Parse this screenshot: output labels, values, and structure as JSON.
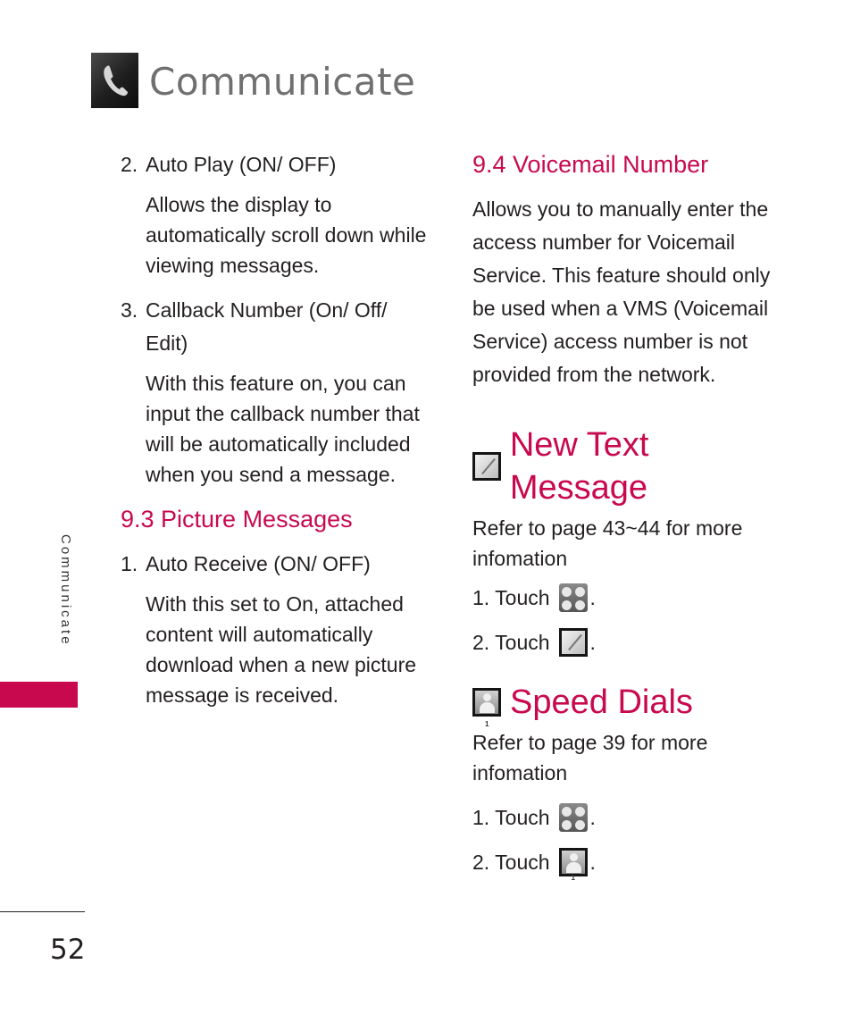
{
  "header": {
    "icon": "phone-icon",
    "title": "Communicate"
  },
  "side_tab": {
    "label": "Communicate",
    "accent_color": "#c8094e"
  },
  "page_number": "52",
  "left_column": {
    "items_top": [
      {
        "num": "2.",
        "title": "Auto Play (ON/ OFF)",
        "body": "Allows the display to automatically scroll down while viewing messages."
      },
      {
        "num": "3.",
        "title": "Callback Number (On/ Off/ Edit)",
        "body": "With this feature on, you can input the callback number that will be automatically included when you send a message."
      }
    ],
    "subsection": {
      "title": "9.3 Picture Messages",
      "items": [
        {
          "num": "1.",
          "title": "Auto Receive (ON/ OFF)",
          "body": "With this set to On, attached content will automatically download when a new picture message is received."
        }
      ]
    }
  },
  "right_column": {
    "voicemail": {
      "title": "9.4 Voicemail Number",
      "body": "Allows you to manually enter the access number for Voicemail Service. This feature should only be used when a VMS (Voicemail Service) access number is not provided from the network."
    },
    "new_text_message": {
      "icon": "new-message-icon",
      "title": "New Text Message",
      "body": "Refer to page 43~44 for more infomation",
      "steps": [
        {
          "label": "1. Touch",
          "icon": "menu-grid-icon",
          "suffix": "."
        },
        {
          "label": "2. Touch",
          "icon": "new-message-icon",
          "suffix": "."
        }
      ]
    },
    "speed_dials": {
      "icon": "speed-dial-contact-icon",
      "title": "Speed Dials",
      "body": "Refer to page 39 for more infomation",
      "steps": [
        {
          "label": "1. Touch",
          "icon": "menu-grid-icon",
          "suffix": "."
        },
        {
          "label": "2. Touch",
          "icon": "speed-dial-contact-icon",
          "suffix": "."
        }
      ]
    }
  }
}
